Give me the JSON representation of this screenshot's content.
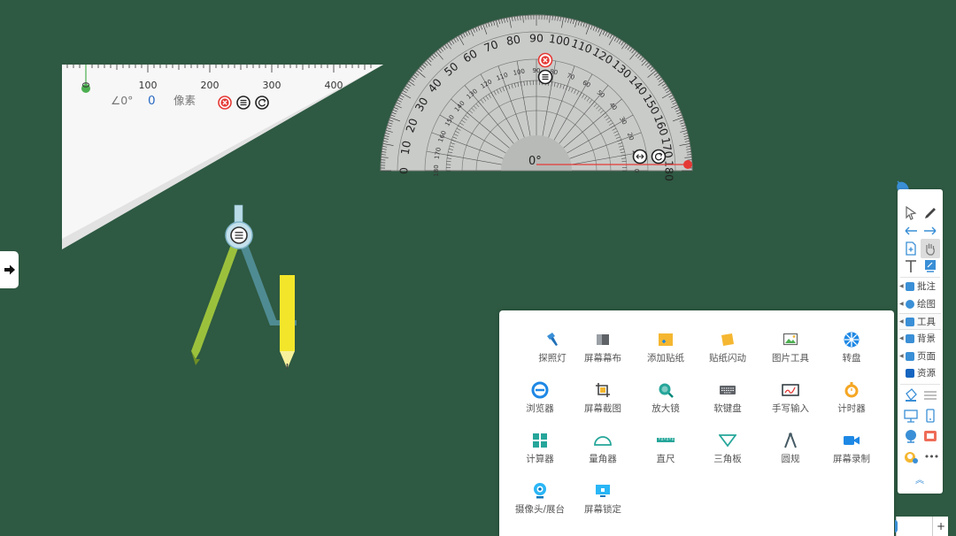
{
  "triangle_ruler": {
    "scale_labels": [
      "0",
      "100",
      "200",
      "300",
      "400"
    ],
    "angle_readout": "∠0°",
    "length_value": "0",
    "unit_label": "像素",
    "buttons": [
      "close-icon",
      "menu-icon",
      "rotate-icon"
    ]
  },
  "protractor": {
    "outer_labels": [
      "0",
      "10",
      "20",
      "30",
      "40",
      "50",
      "60",
      "70",
      "80",
      "90",
      "100",
      "110",
      "120",
      "130",
      "140",
      "150",
      "160",
      "170",
      "180"
    ],
    "angle_readout": "0°",
    "buttons": [
      "close-icon",
      "menu-icon",
      "swap-icon",
      "rotate-icon"
    ]
  },
  "compass": {
    "handle_icon": "menu-icon"
  },
  "left_expander": {
    "icon": "arrow-right-icon"
  },
  "tools_panel": {
    "items": [
      {
        "label": "探照灯",
        "icon": "flashlight-icon"
      },
      {
        "label": "屏幕幕布",
        "icon": "screen-curtain-icon"
      },
      {
        "label": "添加贴纸",
        "icon": "add-sticker-icon"
      },
      {
        "label": "贴纸闪动",
        "icon": "sticker-flash-icon"
      },
      {
        "label": "图片工具",
        "icon": "image-tool-icon"
      },
      {
        "label": "转盘",
        "icon": "spinner-wheel-icon"
      },
      {
        "label": "浏览器",
        "icon": "browser-icon"
      },
      {
        "label": "屏幕截图",
        "icon": "screenshot-icon"
      },
      {
        "label": "放大镜",
        "icon": "magnifier-icon"
      },
      {
        "label": "软键盘",
        "icon": "keyboard-icon"
      },
      {
        "label": "手写输入",
        "icon": "handwriting-icon"
      },
      {
        "label": "计时器",
        "icon": "timer-icon"
      },
      {
        "label": "计算器",
        "icon": "calculator-icon"
      },
      {
        "label": "量角器",
        "icon": "protractor-icon"
      },
      {
        "label": "直尺",
        "icon": "ruler-icon"
      },
      {
        "label": "三角板",
        "icon": "triangle-ruler-icon"
      },
      {
        "label": "圆规",
        "icon": "compass-icon"
      },
      {
        "label": "屏幕录制",
        "icon": "screen-record-icon"
      },
      {
        "label": "摄像头/展台",
        "icon": "camera-icon"
      },
      {
        "label": "屏幕锁定",
        "icon": "screen-lock-icon"
      }
    ]
  },
  "right_toolbar": {
    "menu_items": [
      {
        "label": "批注",
        "icon": "annotate-icon"
      },
      {
        "label": "绘图",
        "icon": "draw-icon"
      },
      {
        "label": "工具",
        "icon": "tools-icon"
      },
      {
        "label": "背景",
        "icon": "background-icon"
      },
      {
        "label": "页面",
        "icon": "page-icon"
      },
      {
        "label": "资源",
        "icon": "resource-icon"
      }
    ],
    "more_label": "•••",
    "collapse_label": "︽"
  },
  "bottom_strip": {
    "plus_label": "+"
  },
  "colors": {
    "board": "#2e5942",
    "accent_blue": "#3a8fd6",
    "close_red": "#e53935",
    "compass_green": "#9bc13c",
    "compass_teal": "#4f8b92",
    "pencil_yellow": "#f3e62a"
  }
}
